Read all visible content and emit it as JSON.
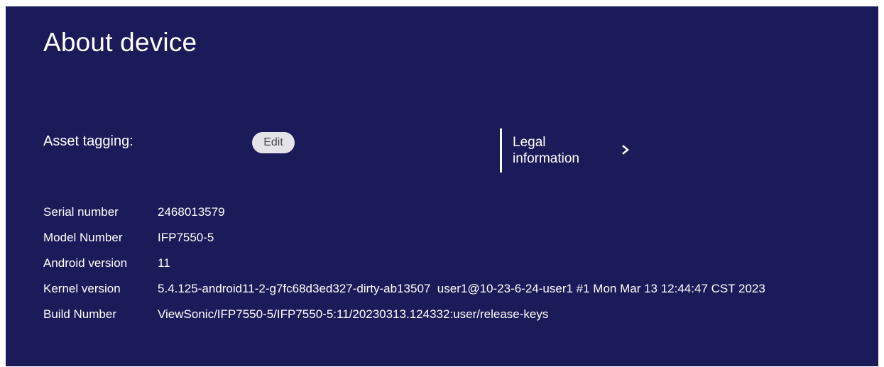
{
  "page": {
    "title": "About device"
  },
  "asset_tagging": {
    "label": "Asset tagging:",
    "edit_label": "Edit"
  },
  "legal": {
    "label_line1": "Legal",
    "label_line2": "information",
    "icon": "chevron-right-icon"
  },
  "info": [
    {
      "label": "Serial number",
      "value": "2468013579"
    },
    {
      "label": "Model Number",
      "value": "IFP7550-5"
    },
    {
      "label": "Android version",
      "value": "11"
    },
    {
      "label": "Kernel version",
      "value": "5.4.125-android11-2-g7fc68d3ed327-dirty-ab13507  user1@10-23-6-24-user1 #1 Mon Mar 13 12:44:47 CST 2023"
    },
    {
      "label": "Build Number",
      "value": "ViewSonic/IFP7550-5/IFP7550-5:11/20230313.124332:user/release-keys"
    }
  ],
  "colors": {
    "background": "#1c1b59",
    "text": "#ffffff",
    "button_bg": "#e4e4e8"
  }
}
